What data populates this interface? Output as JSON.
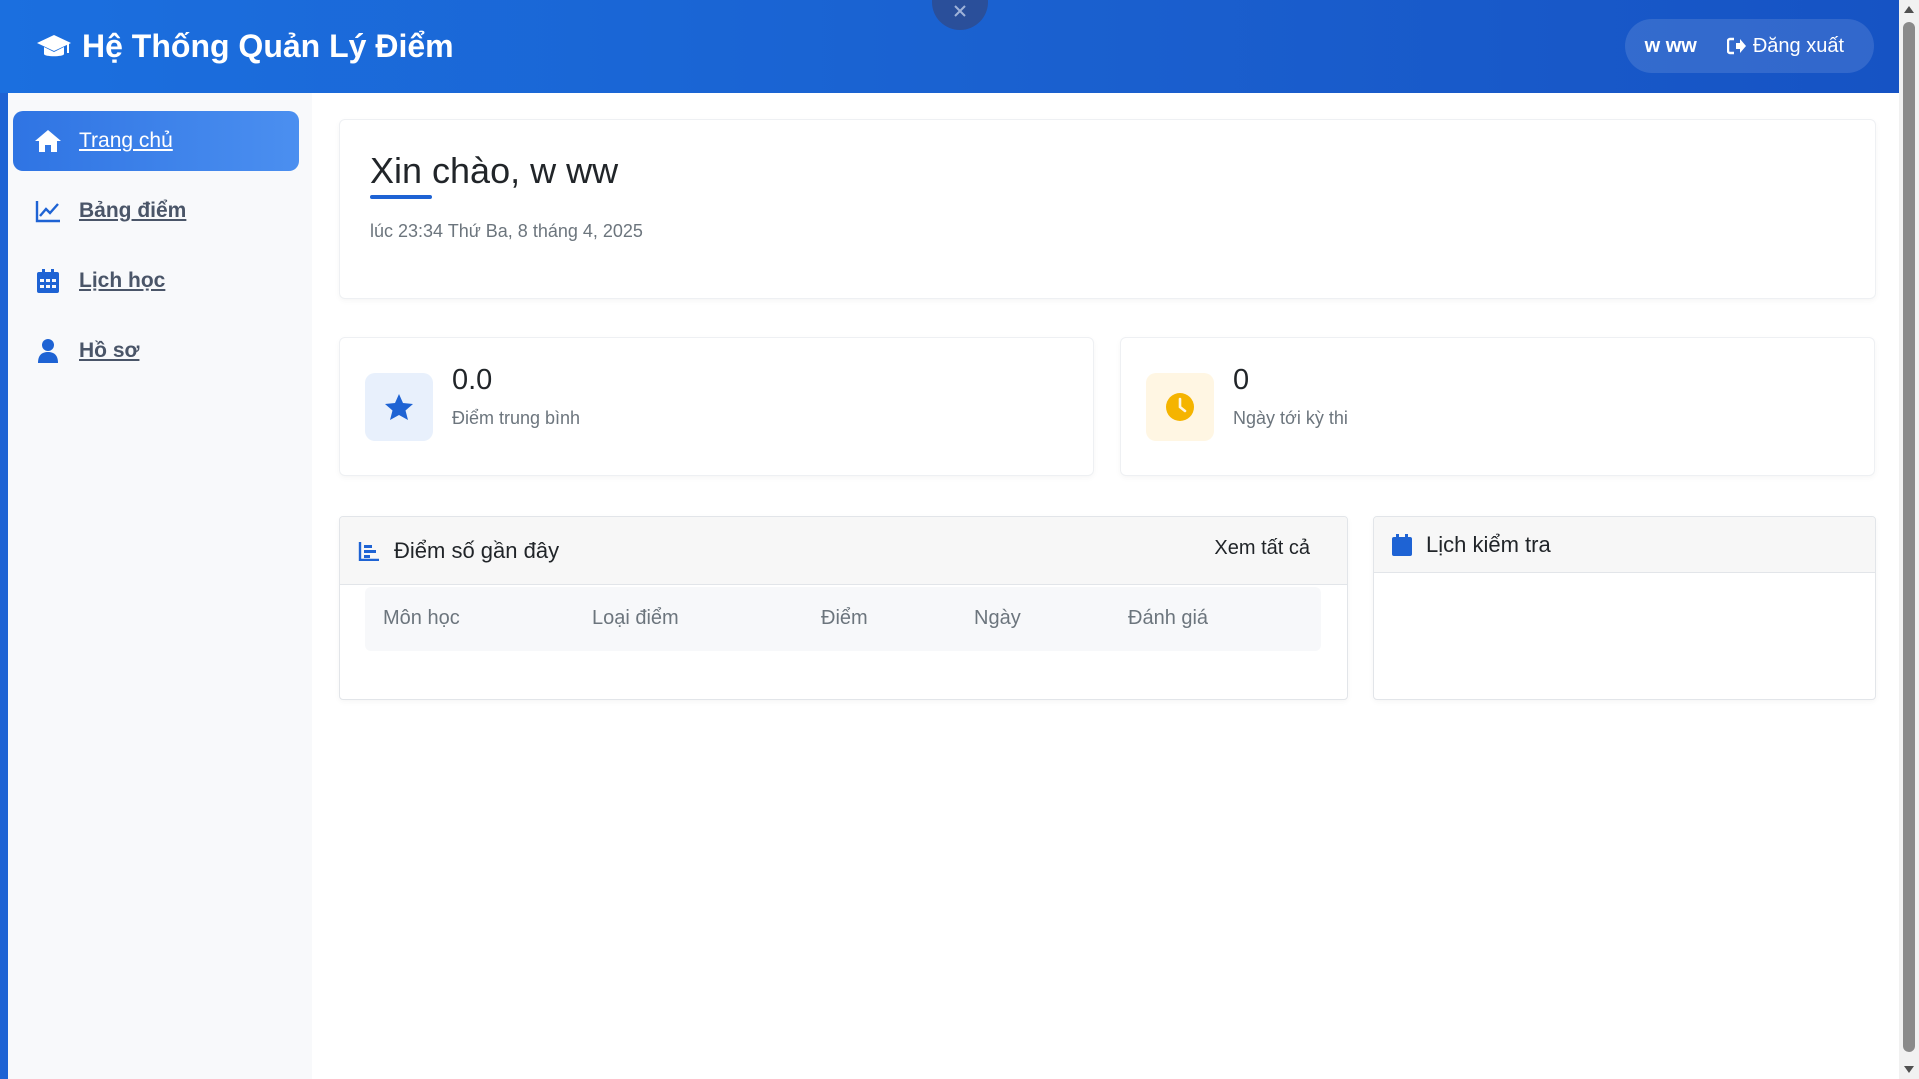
{
  "app": {
    "title": "Hệ Thống Quản Lý Điểm",
    "brand_icon": "graduation-cap-icon",
    "accent_color": "#1e63d4"
  },
  "header": {
    "user_name": "w ww",
    "logout_label": "Đăng xuất"
  },
  "sidebar": {
    "items": [
      {
        "label": "Trang chủ",
        "icon": "home-icon",
        "active": true
      },
      {
        "label": "Bảng điểm",
        "icon": "chart-line-icon",
        "active": false
      },
      {
        "label": "Lịch học",
        "icon": "calendar-icon",
        "active": false
      },
      {
        "label": "Hồ sơ",
        "icon": "user-icon",
        "active": false
      }
    ]
  },
  "welcome": {
    "greeting": "Xin chào, w ww",
    "datetime": "lúc 23:34 Thứ Ba, 8 tháng 4, 2025"
  },
  "stats": [
    {
      "value": "0.0",
      "label": "Điểm trung bình",
      "icon": "star-icon",
      "color": "#1e63d4"
    },
    {
      "value": "0",
      "label": "Ngày tới kỳ thi",
      "icon": "clock-icon",
      "color": "#f5b400"
    }
  ],
  "recent_grades": {
    "title": "Điểm số gần đây",
    "view_all": "Xem tất cả",
    "columns": [
      "Môn học",
      "Loại điểm",
      "Điểm",
      "Ngày",
      "Đánh giá"
    ],
    "rows": []
  },
  "exam_schedule": {
    "title": "Lịch kiểm tra",
    "items": []
  }
}
